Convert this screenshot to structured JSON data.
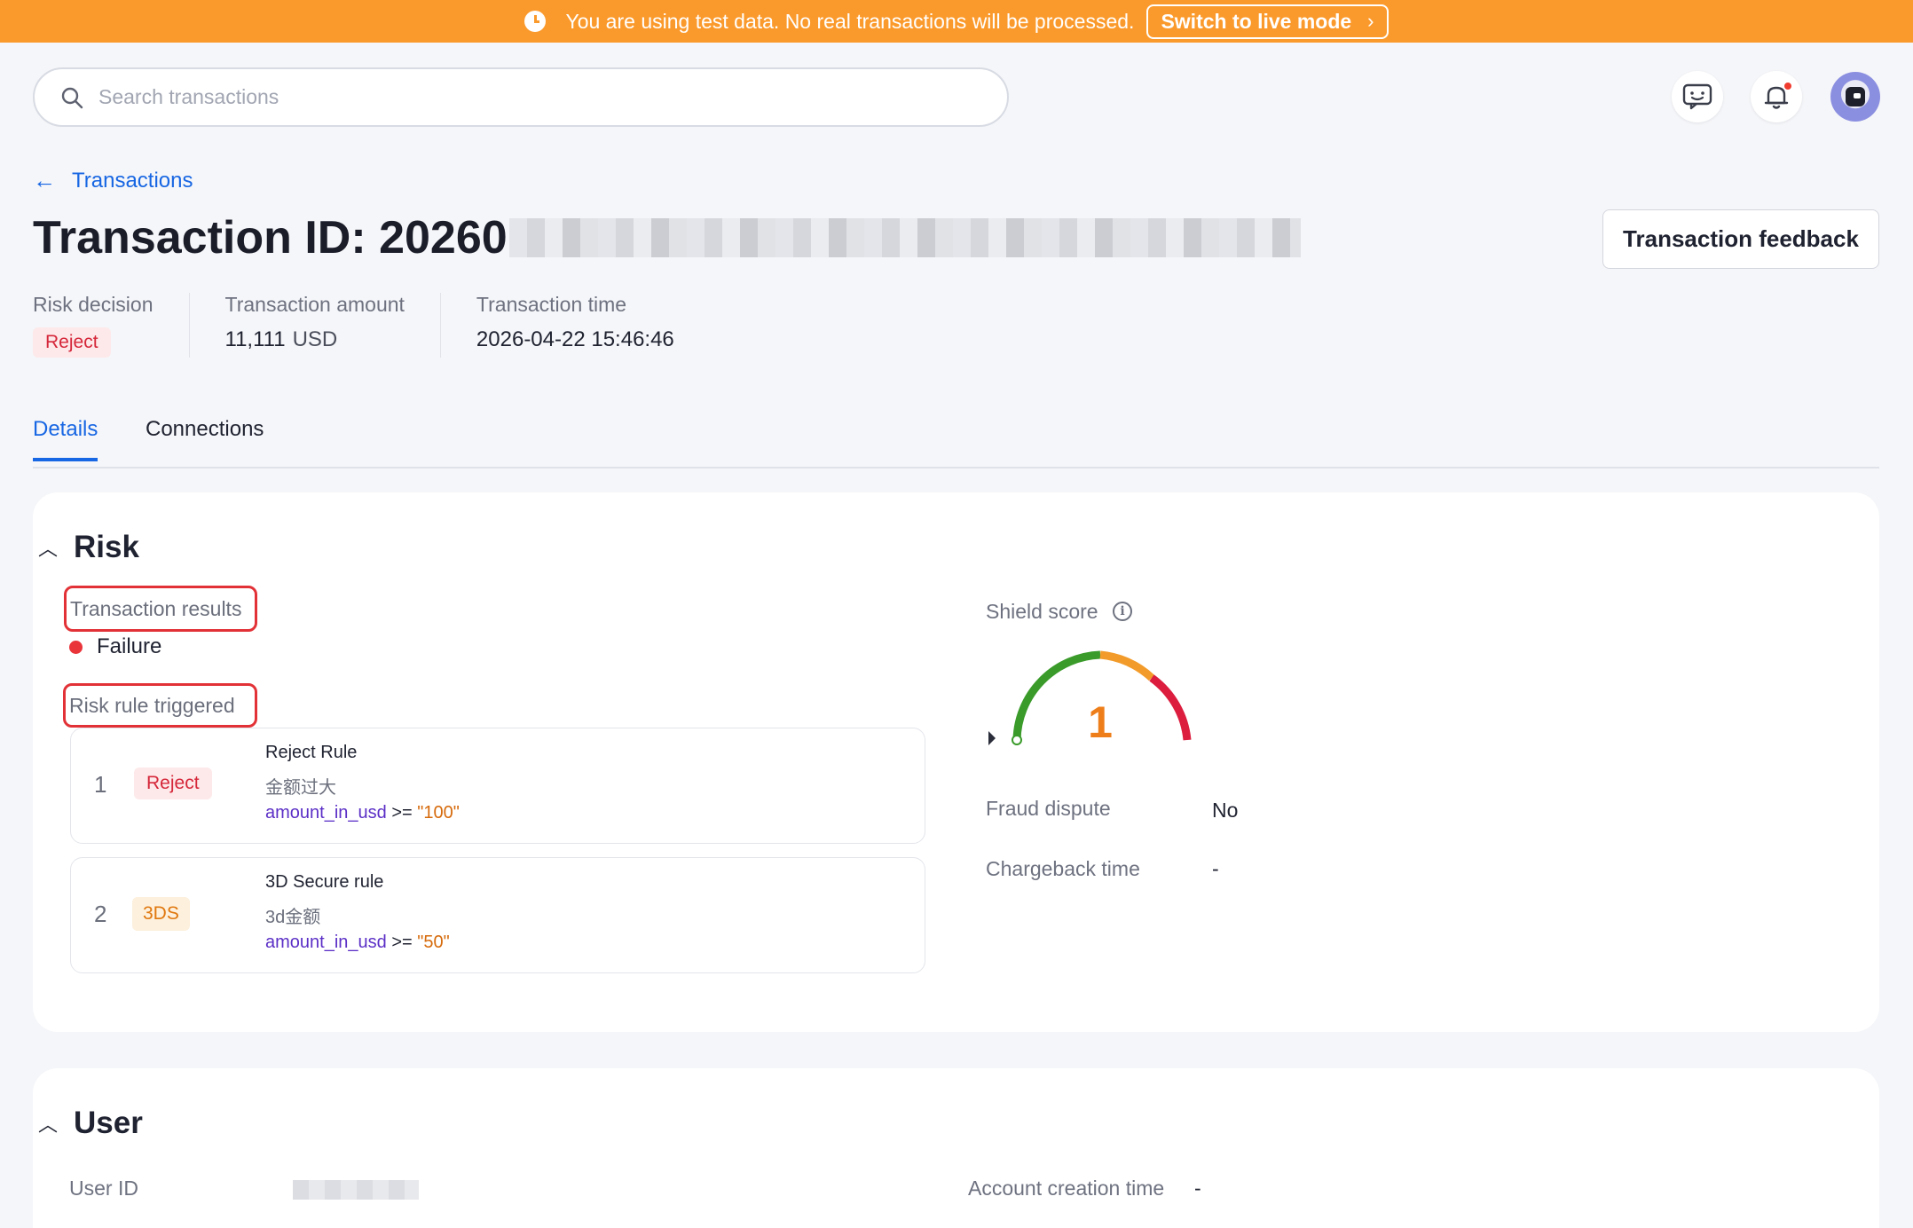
{
  "banner": {
    "message": "You are using test data. No real transactions will be processed.",
    "live_button": "Switch to live mode",
    "background": "#fb9a2c"
  },
  "search": {
    "placeholder": "Search transactions"
  },
  "breadcrumb": {
    "back_label": "Transactions"
  },
  "header": {
    "title_prefix": "Transaction ID: 20260",
    "feedback_button": "Transaction feedback"
  },
  "summary": {
    "risk_decision_label": "Risk decision",
    "risk_decision_value": "Reject",
    "amount_label": "Transaction amount",
    "amount_value": "11,111",
    "amount_currency": "USD",
    "time_label": "Transaction time",
    "time_value": "2026-04-22 15:46:46"
  },
  "tabs": [
    {
      "label": "Details",
      "active": true
    },
    {
      "label": "Connections",
      "active": false
    }
  ],
  "risk": {
    "title": "Risk",
    "results_label": "Transaction results",
    "results_value": "Failure",
    "rules_label": "Risk rule triggered",
    "rules": [
      {
        "index": "1",
        "badge": "Reject",
        "name": "Reject Rule",
        "desc": "金额过大",
        "field": "amount_in_usd",
        "op": ">=",
        "value": "\"100\""
      },
      {
        "index": "2",
        "badge": "3DS",
        "name": "3D Secure rule",
        "desc": "3d金额",
        "field": "amount_in_usd",
        "op": ">=",
        "value": "\"50\""
      }
    ],
    "shield_label": "Shield score",
    "shield_score": "1",
    "fraud_label": "Fraud dispute",
    "fraud_value": "No",
    "chargeback_label": "Chargeback time",
    "chargeback_value": "-"
  },
  "user": {
    "title": "User",
    "user_id_label": "User ID",
    "account_creation_label": "Account creation time",
    "account_creation_value": "-"
  },
  "colors": {
    "accent": "#1766e3",
    "reject": "#d5273a",
    "threeds": "#e0780f",
    "highlight": "#e23237"
  }
}
